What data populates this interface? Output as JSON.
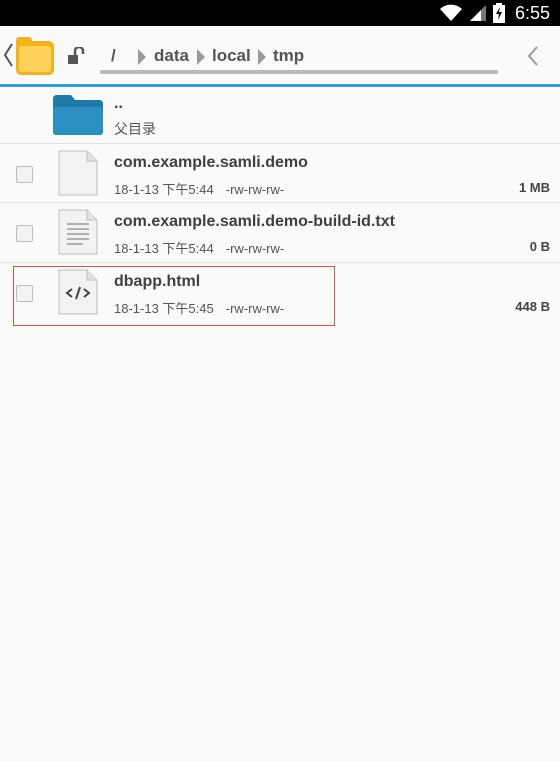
{
  "status_bar": {
    "time": "6:55"
  },
  "breadcrumb": {
    "items": [
      "/",
      "data",
      "local",
      "tmp"
    ]
  },
  "parent": {
    "name": "..",
    "label": "父目录"
  },
  "files": [
    {
      "name": "com.example.samli.demo",
      "date": "18-1-13 下午5:44",
      "perms": "-rw-rw-rw-",
      "size": "1 MB",
      "icon": "file-icon"
    },
    {
      "name": "com.example.samli.demo-build-id.txt",
      "date": "18-1-13 下午5:44",
      "perms": "-rw-rw-rw-",
      "size": "0 B",
      "icon": "text-file-icon"
    },
    {
      "name": "dbapp.html",
      "date": "18-1-13 下午5:45",
      "perms": "-rw-rw-rw-",
      "size": "448 B",
      "icon": "code-file-icon"
    }
  ],
  "colors": {
    "accent": "#2e9fd4",
    "folder": "#2b8fc2",
    "app_folder": "#f6b21b",
    "highlight": "#d9534f"
  }
}
